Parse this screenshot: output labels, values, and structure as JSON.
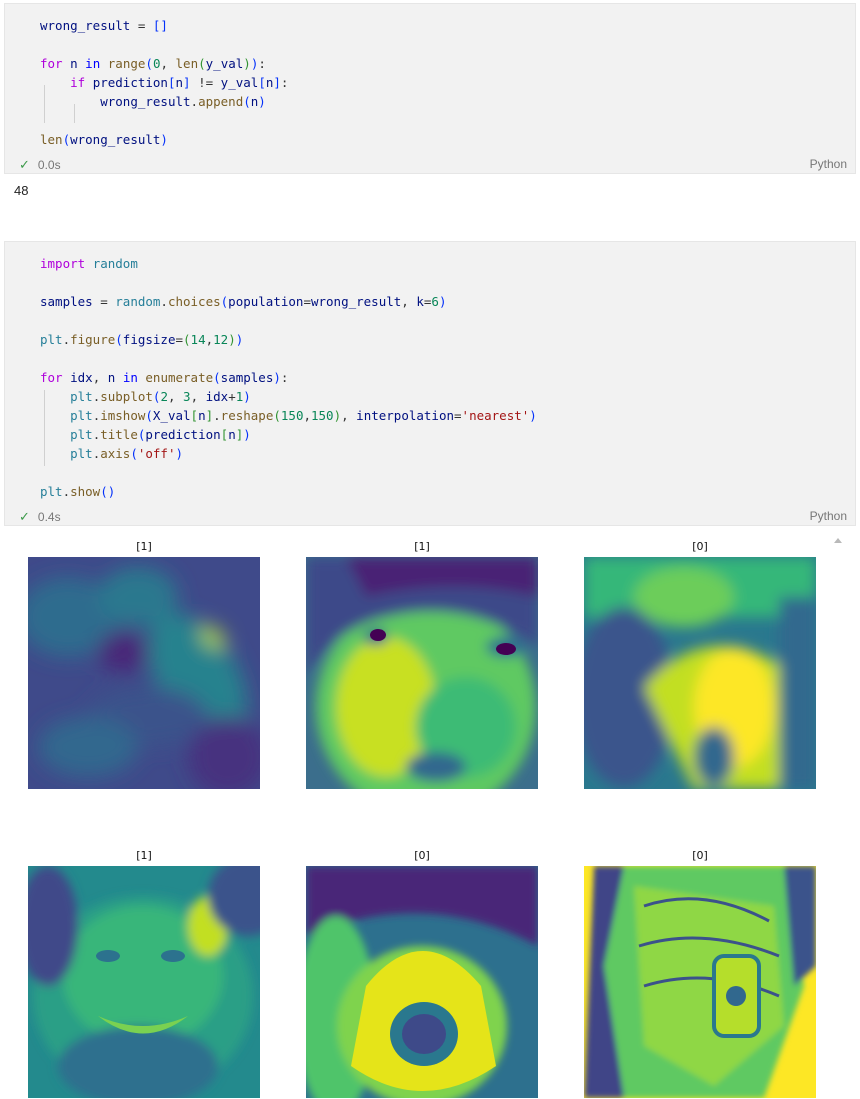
{
  "cell1": {
    "lines": [
      "wrong_result = []",
      "",
      "for n in range(0, len(y_val)):",
      "    if prediction[n] != y_val[n]:",
      "        wrong_result.append(n)",
      "",
      "len(wrong_result)"
    ],
    "time": "0.0s",
    "language": "Python",
    "output": "48"
  },
  "cell2": {
    "lines": [
      "import random",
      "",
      "samples = random.choices(population=wrong_result, k=6)",
      "",
      "plt.figure(figsize=(14,12))",
      "",
      "for idx, n in enumerate(samples):",
      "    plt.subplot(2, 3, idx+1)",
      "    plt.imshow(X_val[n].reshape(150,150), interpolation='nearest')",
      "    plt.title(prediction[n])",
      "    plt.axis('off')",
      "",
      "plt.show()"
    ],
    "time": "0.4s",
    "language": "Python"
  },
  "figure": {
    "colormap": "viridis",
    "subplots": [
      {
        "title": "[1]",
        "subject": "blurry face close-up"
      },
      {
        "title": "[1]",
        "subject": "person with bangs, eye close-up"
      },
      {
        "title": "[0]",
        "subject": "blurry masked face"
      },
      {
        "title": "[1]",
        "subject": "smiling bearded man"
      },
      {
        "title": "[0]",
        "subject": "face with respirator mask"
      },
      {
        "title": "[0]",
        "subject": "person wearing KN95 mask"
      }
    ]
  }
}
